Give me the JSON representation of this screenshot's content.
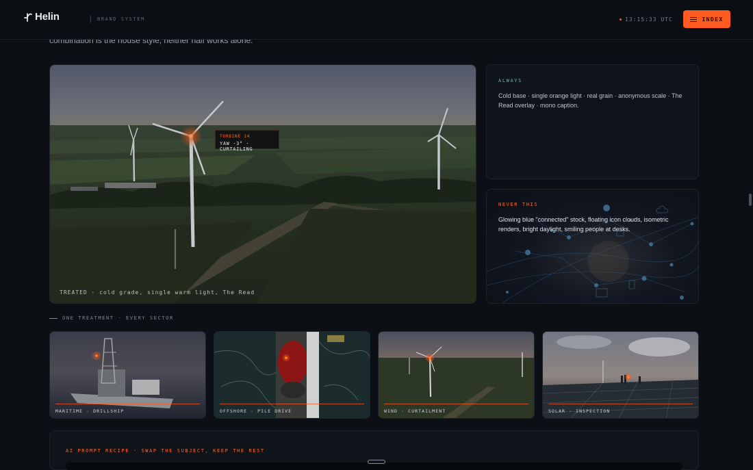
{
  "header": {
    "logo_text": "Helin",
    "brand_label": "BRAND SYSTEM",
    "clock": "13:15:33 UTC",
    "index_label": "INDEX"
  },
  "intro": {
    "partial_text": "combination is the house style, neither half works alone."
  },
  "hero": {
    "caption": "TREATED · cold grade, single warm light, The Read",
    "tag_title": "TURBINE 14",
    "tag_line": "YAW -3° · CURTAILING"
  },
  "always_card": {
    "label": "ALWAYS",
    "body": "Cold base · single orange light · real grain · anonymous scale · The Read overlay · mono caption."
  },
  "never_card": {
    "label": "NEVER THIS",
    "body": "Glowing blue \"connected\" stock, floating icon clouds, isometric renders, bright daylight, smiling people at desks."
  },
  "sectors": {
    "label": "ONE TREATMENT · EVERY SECTOR",
    "items": [
      {
        "caption": "MARITIME · DRILLSHIP"
      },
      {
        "caption": "OFFSHORE · PILE DRIVE"
      },
      {
        "caption": "WIND · CURTAILMENT"
      },
      {
        "caption": "SOLAR · INSPECTION"
      }
    ]
  },
  "recipe": {
    "label": "AI PROMPT RECIPE · SWAP THE SUBJECT, KEEP THE REST"
  },
  "colors": {
    "accent": "#ff5a1f",
    "always_label": "#6fb3a2",
    "background": "#0c1014"
  }
}
